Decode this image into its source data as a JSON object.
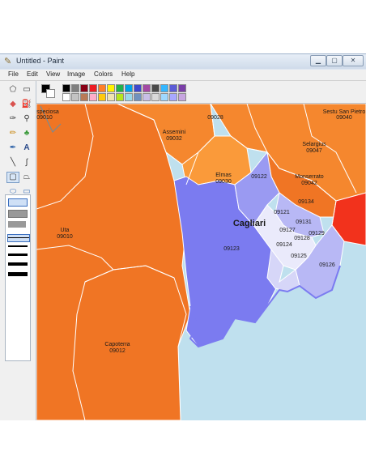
{
  "window": {
    "title": "Untitled - Paint"
  },
  "icons": {
    "app": "paint-app-icon",
    "minimize": "minimize-icon",
    "maximize": "maximize-icon",
    "close": "close-icon"
  },
  "menu": [
    "File",
    "Edit",
    "View",
    "Image",
    "Colors",
    "Help"
  ],
  "tools": [
    "free-select-icon",
    "rect-select-icon",
    "eraser-icon",
    "fill-bucket-icon",
    "color-picker-icon",
    "magnifier-icon",
    "pencil-icon",
    "brush-icon",
    "airbrush-icon",
    "text-icon",
    "line-icon",
    "curve-icon",
    "rectangle-icon",
    "polygon-icon",
    "ellipse-icon",
    "rounded-rect-icon"
  ],
  "palette": {
    "foreground": "#000000",
    "background": "#ffffff",
    "colors": [
      "#000000",
      "#808080",
      "#800000",
      "#808000",
      "#008000",
      "#008080",
      "#000080",
      "#800080",
      "#808040",
      "#004040",
      "#0080ff",
      "#004080",
      "#8000ff",
      "#804000",
      "#ffffff",
      "#c0c0c0",
      "#ff0000",
      "#ffff00",
      "#00ff00",
      "#00ffff",
      "#0000ff",
      "#ff00ff",
      "#ffff80",
      "#00ff80",
      "#80ffff",
      "#8080ff",
      "#ff0080",
      "#ff8040"
    ],
    "row1": [
      "#000000",
      "#7f7f7f",
      "#880015",
      "#ed1c24",
      "#ff7f27",
      "#fff200",
      "#22b14c",
      "#00a2e8",
      "#3f48cc",
      "#a349a4",
      "#4b4b4b",
      "#34b6ff",
      "#5b5bd6",
      "#7a3ea8"
    ],
    "row2": [
      "#ffffff",
      "#c3c3c3",
      "#b97a57",
      "#ffaec9",
      "#ffc90e",
      "#efe4b0",
      "#b5e61d",
      "#99d9ea",
      "#7092be",
      "#c8bfe7",
      "#d9d9d9",
      "#9fd8ff",
      "#a8a8ff",
      "#c7a5e0"
    ]
  },
  "map": {
    "colors": {
      "sea": "#bfe0ee",
      "orange_dark": "#f07524",
      "orange_mid": "#f5872e",
      "orange_light": "#fa9a3a",
      "red": "#f2321c",
      "blue_main": "#7b7bf0",
      "blue_mid": "#9a9af2",
      "blue_light": "#b8b8f5",
      "blue_pale": "#d6d6f8",
      "blue_white": "#eaeafb"
    },
    "labels": {
      "speciosa_name": "speciosa",
      "speciosa_code": "09010",
      "code_09028": "09028",
      "sestu_name": "Sestu San Pietro",
      "sestu_code": "09040",
      "assemini_name": "Assemini",
      "assemini_code": "09032",
      "selargius_name": "Selargius",
      "selargius_code": "09047",
      "elmas_name": "Elmas",
      "elmas_code": "09030",
      "code_09122": "09122",
      "monserrato_name": "Monserrato",
      "monserrato_code": "09042",
      "code_09134": "09134",
      "cagliari_name": "Cagliari",
      "code_09121": "09121",
      "code_09131": "09131",
      "code_09127": "09127",
      "code_09129": "09129",
      "code_09128": "09128",
      "code_09124": "09124",
      "code_09123": "09123",
      "code_09125": "09125",
      "code_09126": "09126",
      "uta_name": "Uta",
      "uta_code": "09010",
      "capoterra_name": "Capoterra",
      "capoterra_code": "09012"
    }
  }
}
